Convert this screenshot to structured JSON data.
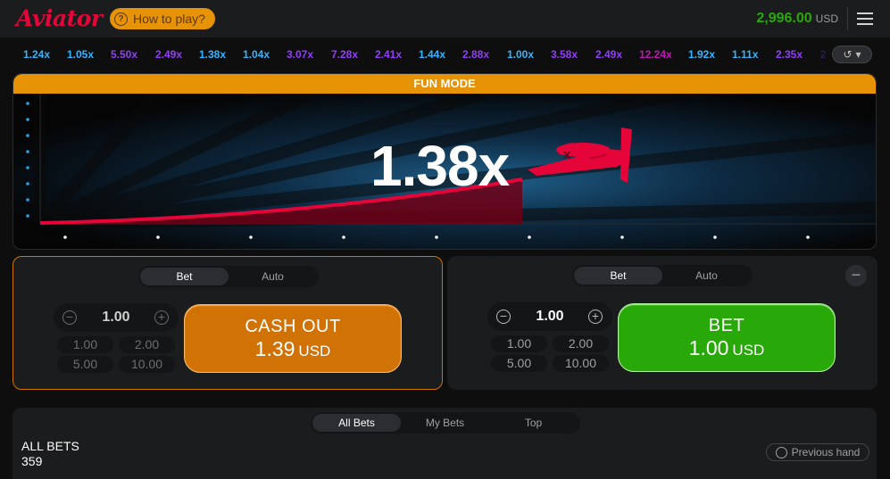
{
  "header": {
    "logo": "Aviator",
    "how_to_play": "How to play?",
    "balance": "2,996.00",
    "currency": "USD"
  },
  "history": [
    {
      "value": "1.24x",
      "color": "#34b4ff"
    },
    {
      "value": "1.05x",
      "color": "#34b4ff"
    },
    {
      "value": "5.50x",
      "color": "#913ef8"
    },
    {
      "value": "2.49x",
      "color": "#913ef8"
    },
    {
      "value": "1.38x",
      "color": "#34b4ff"
    },
    {
      "value": "1.04x",
      "color": "#34b4ff"
    },
    {
      "value": "3.07x",
      "color": "#913ef8"
    },
    {
      "value": "7.28x",
      "color": "#913ef8"
    },
    {
      "value": "2.41x",
      "color": "#913ef8"
    },
    {
      "value": "1.44x",
      "color": "#34b4ff"
    },
    {
      "value": "2.88x",
      "color": "#913ef8"
    },
    {
      "value": "1.00x",
      "color": "#34b4ff"
    },
    {
      "value": "3.58x",
      "color": "#913ef8"
    },
    {
      "value": "2.49x",
      "color": "#913ef8"
    },
    {
      "value": "12.24x",
      "color": "#c017b4"
    },
    {
      "value": "1.92x",
      "color": "#34b4ff"
    },
    {
      "value": "1.11x",
      "color": "#34b4ff"
    },
    {
      "value": "2.35x",
      "color": "#913ef8"
    },
    {
      "value": "2",
      "color": "#913ef8"
    }
  ],
  "game": {
    "mode_label": "FUN MODE",
    "multiplier": "1.38x"
  },
  "panel_left": {
    "tab_bet": "Bet",
    "tab_auto": "Auto",
    "amount": "1.00",
    "chips": [
      "1.00",
      "2.00",
      "5.00",
      "10.00"
    ],
    "action_line1": "CASH OUT",
    "action_amount": "1.39",
    "action_currency": "USD"
  },
  "panel_right": {
    "tab_bet": "Bet",
    "tab_auto": "Auto",
    "amount": "1.00",
    "chips": [
      "1.00",
      "2.00",
      "5.00",
      "10.00"
    ],
    "action_line1": "BET",
    "action_amount": "1.00",
    "action_currency": "USD"
  },
  "bets": {
    "tabs": [
      "All Bets",
      "My Bets",
      "Top"
    ],
    "title": "ALL BETS",
    "count": "359",
    "previous_hand": "Previous hand"
  }
}
